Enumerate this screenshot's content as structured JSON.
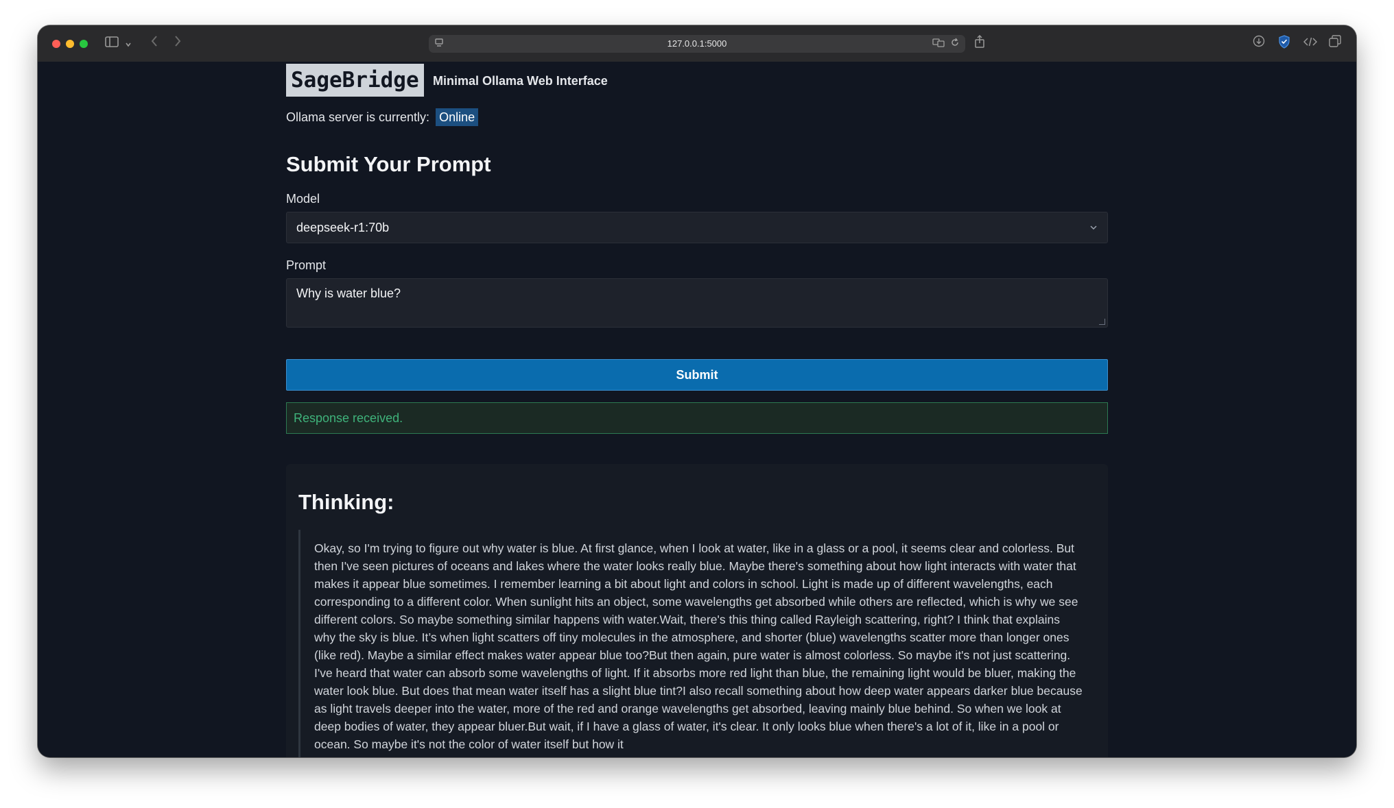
{
  "browser": {
    "url": "127.0.0.1:5000"
  },
  "header": {
    "logo": "SageBridge",
    "subtitle": "Minimal Ollama Web Interface"
  },
  "server_status": {
    "label": "Ollama server is currently:",
    "value": "Online"
  },
  "form": {
    "heading": "Submit Your Prompt",
    "model_label": "Model",
    "model_value": "deepseek-r1:70b",
    "prompt_label": "Prompt",
    "prompt_value": "Why is water blue?",
    "submit_label": "Submit"
  },
  "alert": {
    "text": "Response received."
  },
  "thinking": {
    "title": "Thinking:",
    "text": "Okay, so I'm trying to figure out why water is blue. At first glance, when I look at water, like in a glass or a pool, it seems clear and colorless. But then I've seen pictures of oceans and lakes where the water looks really blue. Maybe there's something about how light interacts with water that makes it appear blue sometimes. I remember learning a bit about light and colors in school. Light is made up of different wavelengths, each corresponding to a different color. When sunlight hits an object, some wavelengths get absorbed while others are reflected, which is why we see different colors. So maybe something similar happens with water.Wait, there's this thing called Rayleigh scattering, right? I think that explains why the sky is blue. It’s when light scatters off tiny molecules in the atmosphere, and shorter (blue) wavelengths scatter more than longer ones (like red). Maybe a similar effect makes water appear blue too?But then again, pure water is almost colorless. So maybe it's not just scattering. I've heard that water can absorb some wavelengths of light. If it absorbs more red light than blue, the remaining light would be bluer, making the water look blue. But does that mean water itself has a slight blue tint?I also recall something about how deep water appears darker blue because as light travels deeper into the water, more of the red and orange wavelengths get absorbed, leaving mainly blue behind. So when we look at deep bodies of water, they appear bluer.But wait, if I have a glass of water, it's clear. It only looks blue when there's a lot of it, like in a pool or ocean. So maybe it's not the color of water itself but how it"
  },
  "colors": {
    "background": "#111621",
    "accent": "#0a6cae",
    "success": "#3fb37b",
    "status_badge": "#1c4f80"
  },
  "icons": [
    "sidebar-icon",
    "chevron-down-icon",
    "back-icon",
    "forward-icon",
    "site-settings-icon",
    "translate-icon",
    "reload-icon",
    "share-icon",
    "download-icon",
    "shield-icon",
    "code-icon",
    "tabs-icon"
  ]
}
